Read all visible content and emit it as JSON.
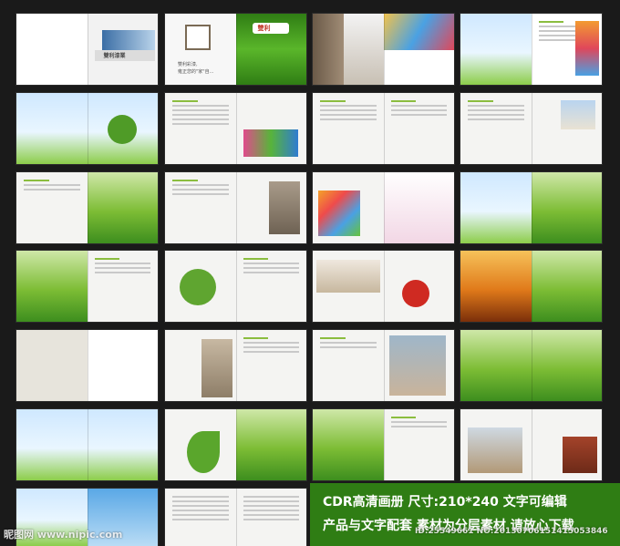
{
  "cover": {
    "brand_name": "雙利漆業",
    "slogan_line1": "雙利彩漆,",
    "slogan_line2": "雍正您的\"家\"自...",
    "green_page_title": "雙利"
  },
  "promo": {
    "line1": "CDR高清画册 尺寸:210*240 文字可编辑",
    "line2": "产品与文字配套 素材为分层素材 请放心下载"
  },
  "watermark": {
    "left": "昵图网 www.nipic.com",
    "right": "ID:25549661 NO:20130706151415053846"
  }
}
